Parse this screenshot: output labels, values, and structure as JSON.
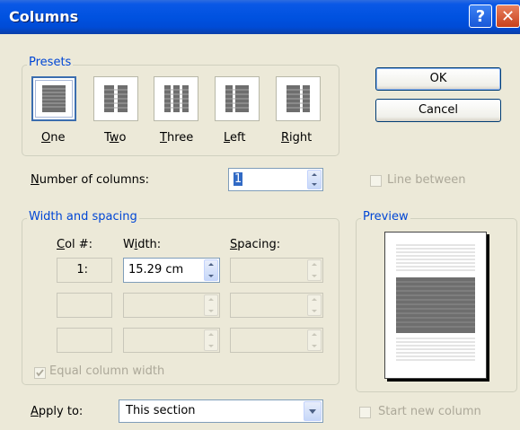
{
  "dialog": {
    "title": "Columns",
    "help_symbol": "?",
    "close_symbol": "✕"
  },
  "presets": {
    "legend": "Presets",
    "items": [
      {
        "id": "one",
        "label": "One",
        "mnemonic": "O",
        "rest": "ne",
        "selected": true
      },
      {
        "id": "two",
        "label": "Two",
        "mnemonic": "w",
        "pre": "T",
        "rest": "o",
        "selected": false
      },
      {
        "id": "three",
        "label": "Three",
        "mnemonic": "T",
        "rest": "hree",
        "selected": false
      },
      {
        "id": "left",
        "label": "Left",
        "mnemonic": "L",
        "rest": "eft",
        "selected": false
      },
      {
        "id": "right",
        "label": "Right",
        "mnemonic": "R",
        "rest": "ight",
        "selected": false
      }
    ]
  },
  "buttons": {
    "ok_label": "OK",
    "cancel_label": "Cancel"
  },
  "number_of_columns": {
    "label_mnemonic": "N",
    "label_rest": "umber of columns:",
    "value": "1"
  },
  "line_between": {
    "label": "Line between",
    "checked": false
  },
  "width_spacing": {
    "legend": "Width and spacing",
    "col_header_mnemonic": "C",
    "col_header_rest": "ol #:",
    "width_header_pre": "W",
    "width_header_mnemonic": "i",
    "width_header_rest": "dth:",
    "spacing_header_mnemonic": "S",
    "spacing_header_rest": "pacing:",
    "rows": [
      {
        "col": "1:",
        "width": "15.29 cm",
        "spacing": ""
      },
      {
        "col": "",
        "width": "",
        "spacing": ""
      },
      {
        "col": "",
        "width": "",
        "spacing": ""
      }
    ]
  },
  "equal_column_width": {
    "label": "Equal column width",
    "checked": true
  },
  "preview": {
    "legend": "Preview"
  },
  "apply_to": {
    "label_mnemonic": "A",
    "label_rest": "pply to:",
    "value": "This section"
  },
  "start_new_column": {
    "label": "Start new column",
    "checked": false
  },
  "colors": {
    "titlebar": "#0052E0",
    "legend_text": "#0046D5",
    "dialog_bg": "#ECE9D8",
    "disabled_text": "#ACA899"
  }
}
